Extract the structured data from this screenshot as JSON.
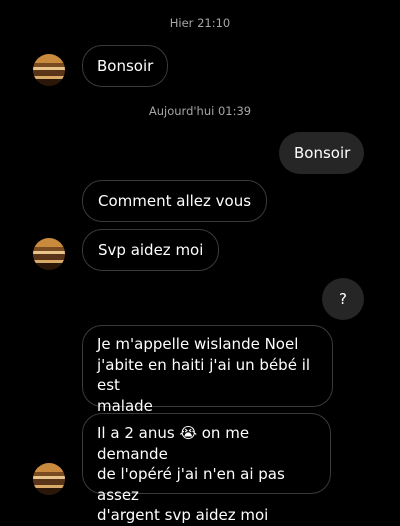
{
  "chat": {
    "timestamps": [
      {
        "text": "Hier 21:10"
      },
      {
        "text": "Aujourd'hui 01:39"
      }
    ],
    "messages": [
      {
        "sender": "contact",
        "text": "Bonsoir"
      },
      {
        "sender": "me",
        "text": "Bonsoir"
      },
      {
        "sender": "contact",
        "text": "Comment allez vous"
      },
      {
        "sender": "contact",
        "text": "Svp aidez moi"
      },
      {
        "sender": "me",
        "text": "?"
      },
      {
        "sender": "contact",
        "lines": [
          "Je m'appelle wislande Noel",
          "j'abite en haiti j'ai un bébé il est",
          "malade"
        ]
      },
      {
        "sender": "contact",
        "line1_before": "Il a 2 anus",
        "emoji": "😭",
        "line1_after": "on me demande",
        "lines": [
          "de l'opéré j'ai n'en ai pas assez",
          "d'argent svp aidez moi"
        ]
      }
    ]
  },
  "avatar": {
    "icon": "contact-avatar-icon"
  },
  "colors": {
    "background": "#000000",
    "incoming_border": "#3a3a3a",
    "outgoing_bubble": "#262626",
    "timestamp_text": "#a6a6a6"
  }
}
